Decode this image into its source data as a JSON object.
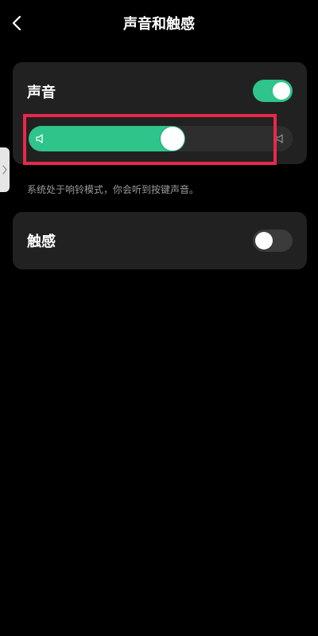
{
  "header": {
    "title": "声音和触感"
  },
  "sound": {
    "label": "声音",
    "toggle_on": true,
    "volume_level": 0.55,
    "hint": "系统处于响铃模式，你会听到按键声音。"
  },
  "haptic": {
    "label": "触感",
    "toggle_on": false
  },
  "icons": {
    "back": "chevron-left-icon",
    "volume_min": "speaker-low-icon",
    "volume_max": "speaker-high-icon",
    "side_handle": "chevron-right-icon"
  },
  "colors": {
    "accent": "#2fc48a",
    "highlight": "#e8284a",
    "card": "#212121",
    "background": "#000000"
  }
}
